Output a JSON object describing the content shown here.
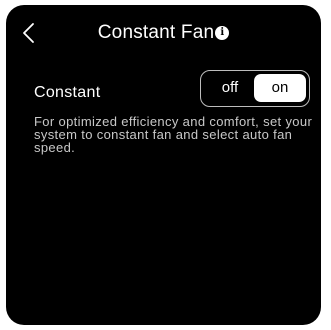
{
  "header": {
    "title": "Constant Fan",
    "info_glyph": "i",
    "back_icon": "chevron-left-icon"
  },
  "setting": {
    "label": "Constant",
    "options": [
      "off",
      "on"
    ],
    "selected": "on",
    "description": "For optimized efficiency and comfort, set your system to constant fan and select auto fan speed."
  },
  "colors": {
    "background": "#000000",
    "text": "#ffffff",
    "muted_text": "#c8c8c8",
    "toggle_border": "#bdbdbd",
    "toggle_selected_bg": "#ffffff"
  }
}
